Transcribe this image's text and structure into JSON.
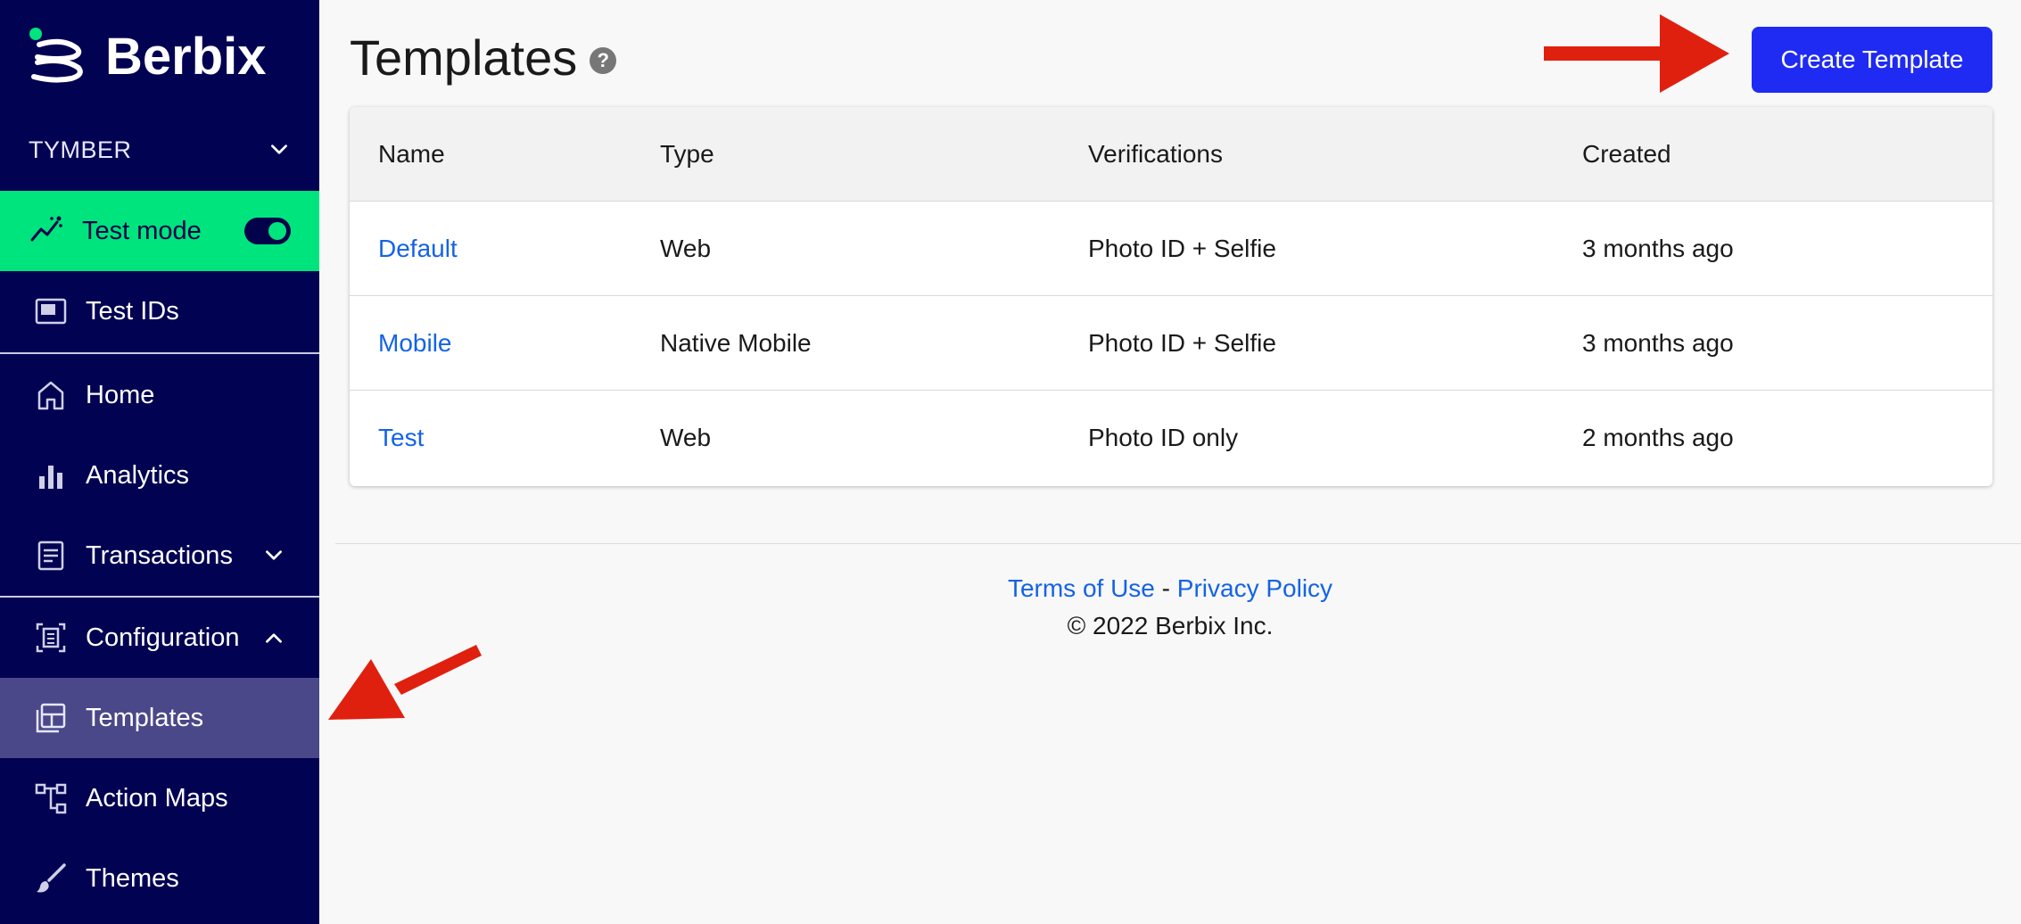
{
  "brand": {
    "name": "Berbix"
  },
  "org": {
    "name": "TYMBER"
  },
  "test_mode": {
    "label": "Test mode",
    "enabled": true
  },
  "sidebar": {
    "items": [
      {
        "label": "Test IDs",
        "icon": "id-card-icon"
      },
      {
        "label": "Home",
        "icon": "home-icon"
      },
      {
        "label": "Analytics",
        "icon": "bar-chart-icon"
      },
      {
        "label": "Transactions",
        "icon": "document-icon"
      },
      {
        "label": "Configuration",
        "icon": "configuration-icon"
      },
      {
        "label": "Templates",
        "icon": "templates-icon",
        "active": true
      },
      {
        "label": "Action Maps",
        "icon": "action-map-icon"
      },
      {
        "label": "Themes",
        "icon": "brush-icon"
      }
    ]
  },
  "page": {
    "title": "Templates",
    "create_button": "Create Template"
  },
  "table": {
    "headers": [
      "Name",
      "Type",
      "Verifications",
      "Created"
    ],
    "rows": [
      [
        "Default",
        "Web",
        "Photo ID + Selfie",
        "3 months ago"
      ],
      [
        "Mobile",
        "Native Mobile",
        "Photo ID + Selfie",
        "3 months ago"
      ],
      [
        "Test",
        "Web",
        "Photo ID only",
        "2 months ago"
      ]
    ]
  },
  "footer": {
    "terms": "Terms of Use",
    "separator": "-",
    "privacy": "Privacy Policy",
    "copyright": "© 2022 Berbix Inc."
  },
  "colors": {
    "sidebar_bg": "#020252",
    "test_mode_bg": "#00e47d",
    "active_item_bg": "#4a4888",
    "primary_button": "#1f2bf2",
    "link": "#1463e6",
    "annotation_arrow": "#e0200f"
  }
}
